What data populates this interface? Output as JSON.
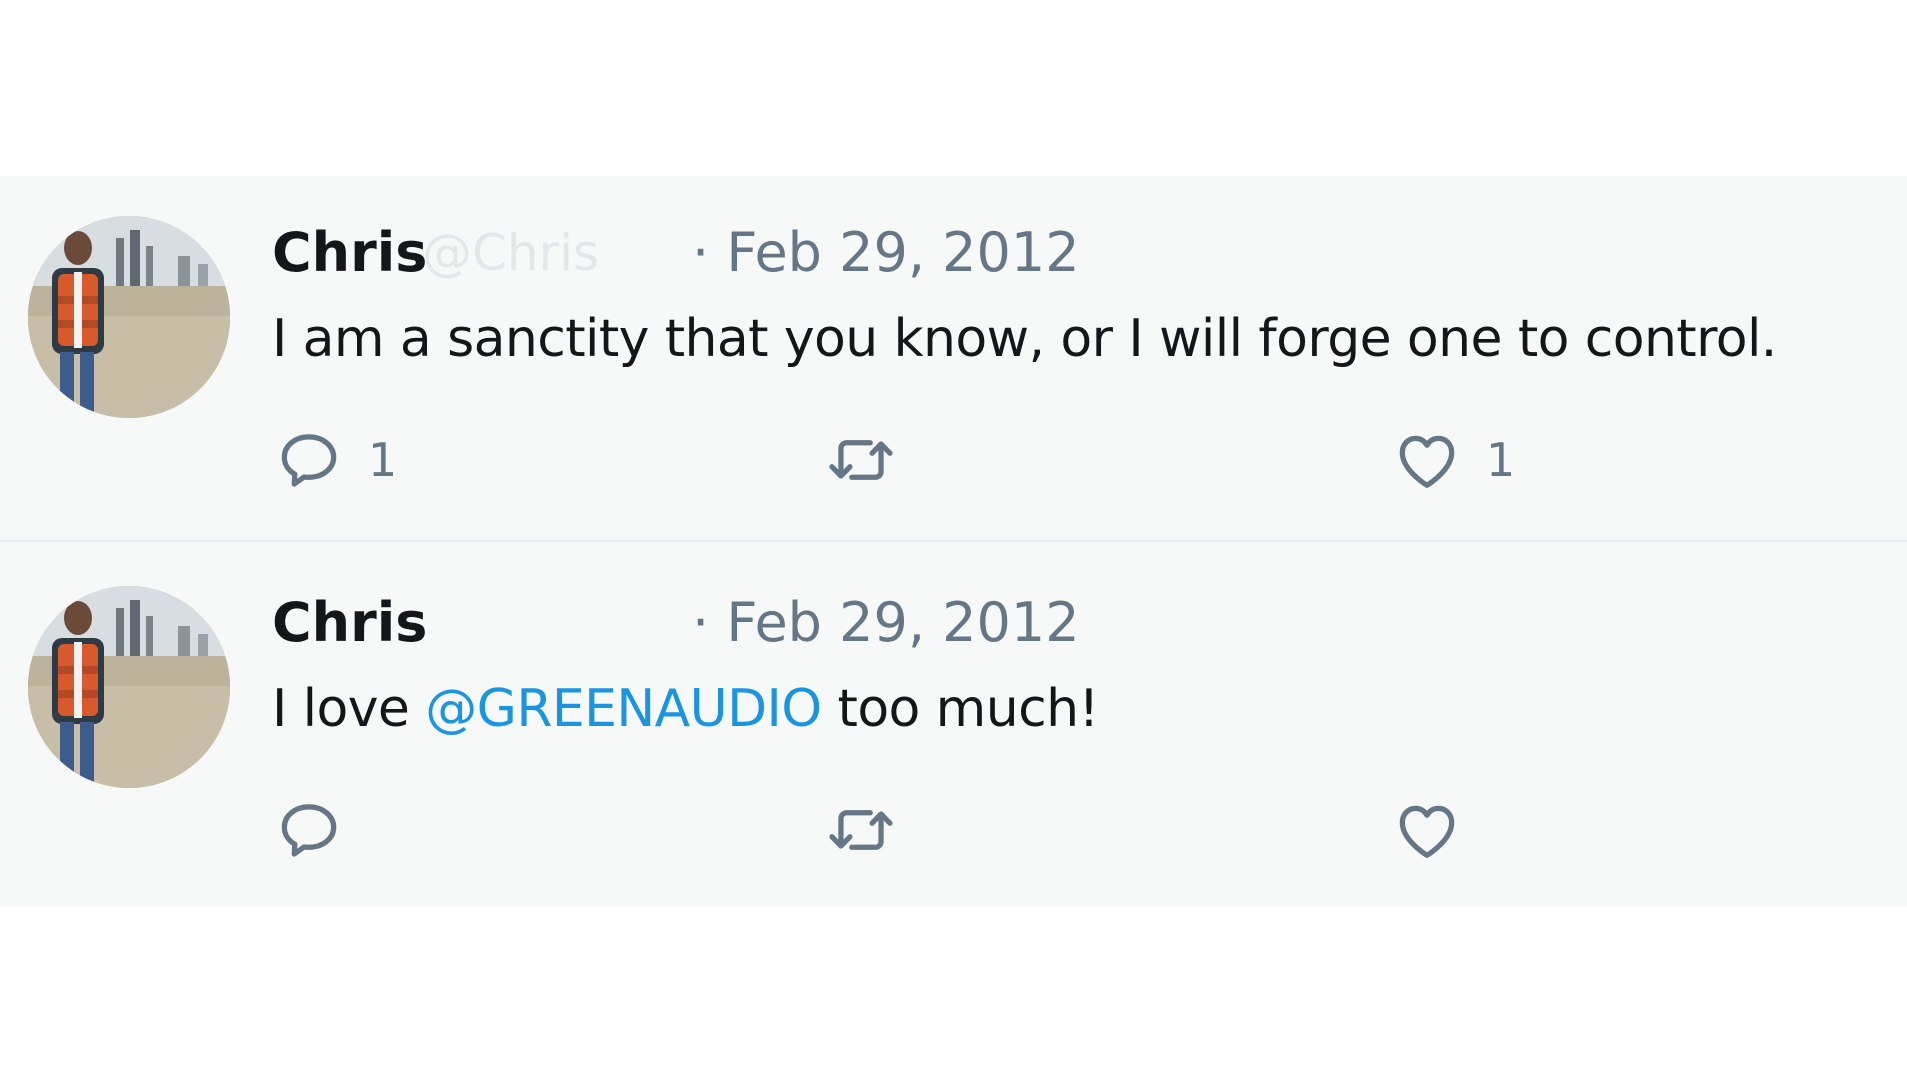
{
  "tweets": [
    {
      "author": "Chris",
      "handle": "@Chris",
      "date": "· Feb 29, 2012",
      "text_parts": {
        "before": "I am a sanctity that you know, or I will forge one to control.",
        "mention": "",
        "after": ""
      },
      "replies": "1",
      "retweets": "",
      "likes": "1"
    },
    {
      "author": "Chris",
      "handle": "",
      "date": "· Feb 29, 2012",
      "text_parts": {
        "before": "I love ",
        "mention": "@GREENAUDIO",
        "after": " too much!"
      },
      "replies": "",
      "retweets": "",
      "likes": ""
    }
  ],
  "icons": {
    "reply": "speech-bubble-icon",
    "retweet": "retweet-arrows-icon",
    "like": "heart-icon"
  },
  "colors": {
    "feed_background": "#f7f8f8",
    "text": "#14171a",
    "secondary": "#657786",
    "mention": "#1b95e0",
    "divider": "#e6ecf0"
  }
}
